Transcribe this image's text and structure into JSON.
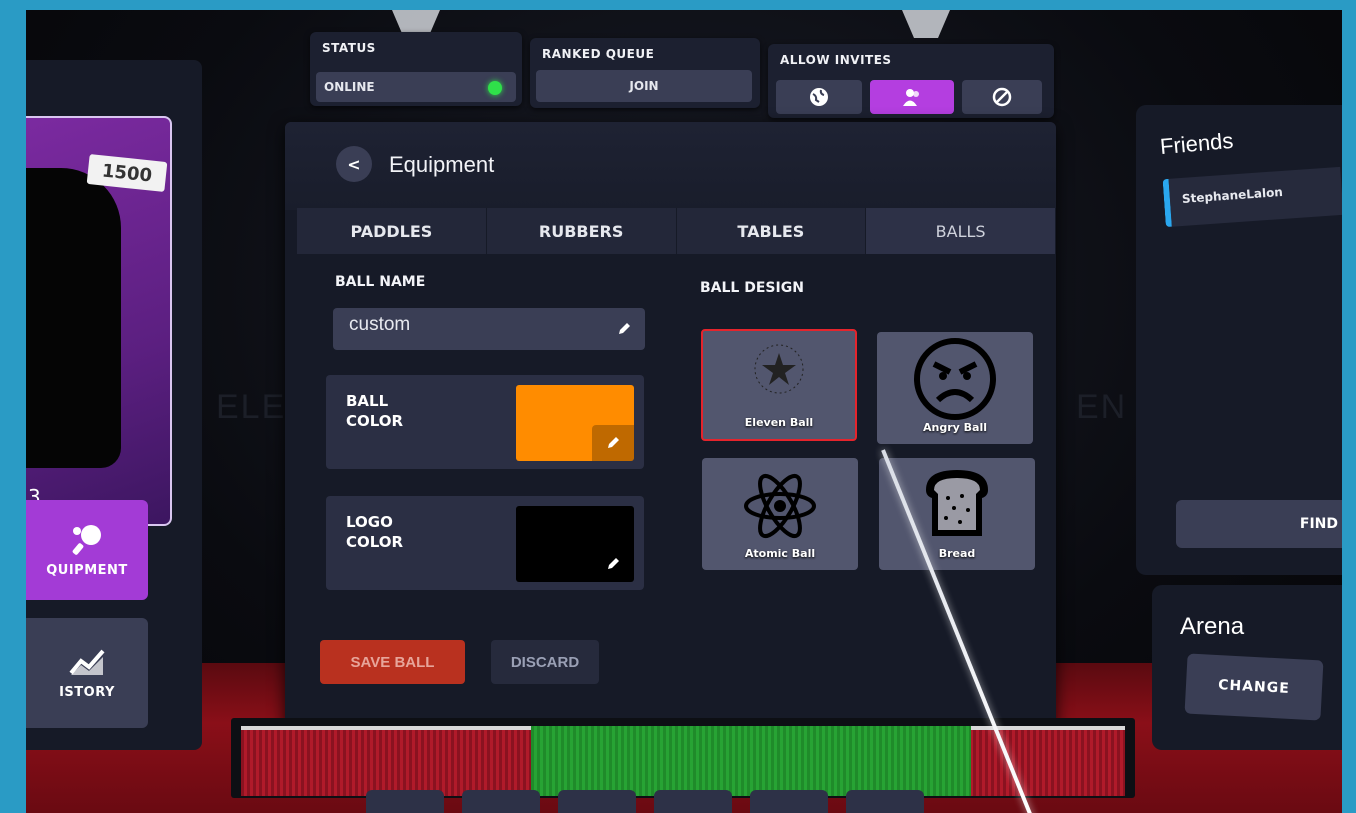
{
  "status_bar": {
    "status_label": "STATUS",
    "status_value": "ONLINE",
    "ranked_label": "RANKED QUEUE",
    "ranked_button": "JOIN",
    "invites_label": "ALLOW INVITES"
  },
  "background": {
    "left_text": "ELE",
    "right_text": "EN"
  },
  "equipment": {
    "back_label": "<",
    "title": "Equipment",
    "tabs": [
      {
        "label": "PADDLES"
      },
      {
        "label": "RUBBERS"
      },
      {
        "label": "TABLES"
      },
      {
        "label": "BALLS"
      }
    ],
    "ball_name_label": "BALL NAME",
    "ball_name_value": "custom",
    "ball_color_label": "BALL\nCOLOR",
    "ball_color_hex": "#ff8c00",
    "logo_color_label": "LOGO\nCOLOR",
    "logo_color_hex": "#000000",
    "ball_design_label": "BALL DESIGN",
    "designs": [
      {
        "name": "Eleven Ball",
        "icon": "star-icon",
        "selected": true
      },
      {
        "name": "Angry Ball",
        "icon": "angry-face-icon",
        "selected": false
      },
      {
        "name": "Atomic Ball",
        "icon": "atom-icon",
        "selected": false
      },
      {
        "name": "Bread",
        "icon": "bread-icon",
        "selected": false
      }
    ],
    "save_button": "SAVE BALL",
    "discard_button": "DISCARD"
  },
  "profile": {
    "rating": "1500",
    "name_fragment": "3",
    "equipment_button": "QUIPMENT",
    "history_button": "ISTORY"
  },
  "friends": {
    "title": "Friends",
    "items": [
      {
        "name": "StephaneLalon"
      }
    ],
    "find_button": "FIND"
  },
  "arena": {
    "title": "Arena",
    "change_button": "CHANGE"
  },
  "colors": {
    "accent_purple": "#b43ee0",
    "online_green": "#2fe04a",
    "selected_red": "#e5242c",
    "save_red": "#b9311f"
  }
}
